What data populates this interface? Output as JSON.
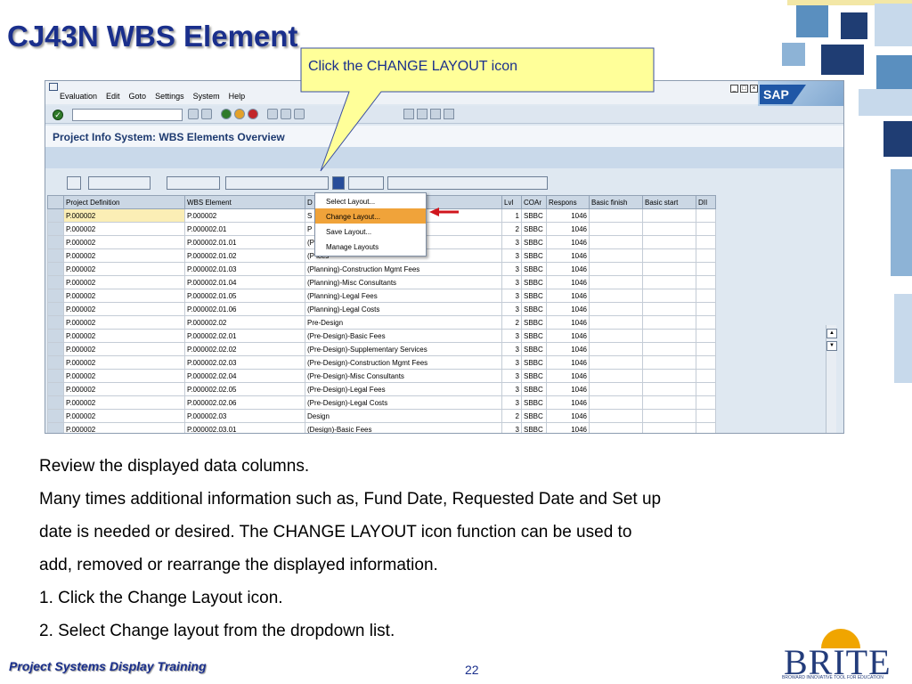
{
  "slide": {
    "title": "CJ43N WBS Element",
    "callout": "Click the CHANGE LAYOUT icon",
    "body_lines": [
      "Review the displayed data columns.",
      "Many times additional information such as, Fund Date, Requested Date and Set up",
      "date is needed or desired.  The CHANGE LAYOUT icon function can be used to",
      "add, removed or rearrange the displayed information.",
      "1. Click the Change Layout icon.",
      "2.  Select Change layout from the dropdown list."
    ],
    "footer_left": "Project Systems Display Training",
    "page_number": "22",
    "logo_word": "BRITE",
    "logo_tagline": "BROWARD INNOVATIVE TOOL FOR EDUCATION"
  },
  "sap": {
    "menu": [
      "Evaluation",
      "Edit",
      "Goto",
      "Settings",
      "System",
      "Help"
    ],
    "logo": "SAP",
    "screen_title": "Project Info System: WBS Elements Overview",
    "columns": [
      "Project Definition",
      "WBS Element",
      "D",
      "Lvl",
      "COAr",
      "Respons",
      "Basic finish",
      "Basic start",
      "DII"
    ],
    "rows": [
      [
        "P.000002",
        "P.000002",
        "S",
        "1",
        "SBBC",
        "1046"
      ],
      [
        "P.000002",
        "P.000002.01",
        "P",
        "2",
        "SBBC",
        "1046"
      ],
      [
        "P.000002",
        "P.000002.01.01",
        "(P",
        "3",
        "SBBC",
        "1046"
      ],
      [
        "P.000002",
        "P.000002.01.02",
        "(P                                      ices",
        "3",
        "SBBC",
        "1046"
      ],
      [
        "P.000002",
        "P.000002.01.03",
        "(Planning)-Construction Mgmt Fees",
        "3",
        "SBBC",
        "1046"
      ],
      [
        "P.000002",
        "P.000002.01.04",
        "(Planning)-Misc Consultants",
        "3",
        "SBBC",
        "1046"
      ],
      [
        "P.000002",
        "P.000002.01.05",
        "(Planning)-Legal Fees",
        "3",
        "SBBC",
        "1046"
      ],
      [
        "P.000002",
        "P.000002.01.06",
        "(Planning)-Legal Costs",
        "3",
        "SBBC",
        "1046"
      ],
      [
        "P.000002",
        "P.000002.02",
        "Pre-Design",
        "2",
        "SBBC",
        "1046"
      ],
      [
        "P.000002",
        "P.000002.02.01",
        "(Pre-Design)-Basic Fees",
        "3",
        "SBBC",
        "1046"
      ],
      [
        "P.000002",
        "P.000002.02.02",
        "(Pre-Design)-Supplementary Services",
        "3",
        "SBBC",
        "1046"
      ],
      [
        "P.000002",
        "P.000002.02.03",
        "(Pre-Design)-Construction Mgmt Fees",
        "3",
        "SBBC",
        "1046"
      ],
      [
        "P.000002",
        "P.000002.02.04",
        "(Pre-Design)-Misc Consultants",
        "3",
        "SBBC",
        "1046"
      ],
      [
        "P.000002",
        "P.000002.02.05",
        "(Pre-Design)-Legal Fees",
        "3",
        "SBBC",
        "1046"
      ],
      [
        "P.000002",
        "P.000002.02.06",
        "(Pre-Design)-Legal Costs",
        "3",
        "SBBC",
        "1046"
      ],
      [
        "P.000002",
        "P.000002.03",
        "Design",
        "2",
        "SBBC",
        "1046"
      ],
      [
        "P.000002",
        "P.000002.03.01",
        "(Design)-Basic Fees",
        "3",
        "SBBC",
        "1046"
      ]
    ],
    "layout_menu": [
      "Select Layout...",
      "Change Layout...",
      "Save Layout...",
      "Manage Layouts"
    ],
    "active_menu_item": "Change Layout..."
  },
  "colors": {
    "title_blue": "#1a2f8c",
    "callout_fill": "#ffff99",
    "menu_highlight": "#f0a33a",
    "selected_cell": "#fbeeb5"
  }
}
